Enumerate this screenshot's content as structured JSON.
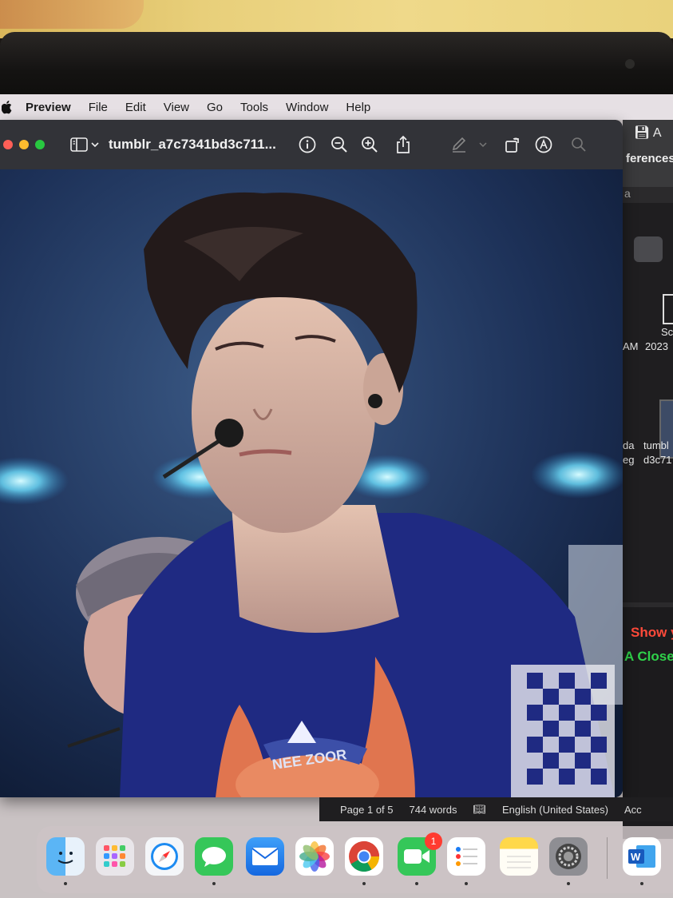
{
  "menubar": {
    "app_name": "Preview",
    "items": [
      "File",
      "Edit",
      "View",
      "Go",
      "Tools",
      "Window",
      "Help"
    ]
  },
  "window": {
    "title": "tumblr_a7c7341bd3c711...",
    "toolbar_icons": [
      "sidebar-icon",
      "chevron-down-icon",
      "info-icon",
      "zoom-out-icon",
      "zoom-in-icon",
      "share-icon",
      "markup-pen-icon",
      "chevron-down-icon",
      "rotate-icon",
      "annotate-icon",
      "search-icon"
    ]
  },
  "background_app": {
    "tab_fragment": "ferences",
    "font_fragment": "a",
    "file_labels": {
      "sc": "Sc",
      "am": "AM",
      "year": "2023",
      "da": "da",
      "eg": "eg",
      "tumbl": "tumbl",
      "d3c71": "d3c71"
    },
    "red_text": "Show y",
    "green_text": "A Close"
  },
  "statusbar": {
    "page": "Page 1 of 5",
    "words": "744 words",
    "language": "English (United States)",
    "accessibility": "Acc"
  },
  "dock": {
    "apps": [
      "Finder",
      "Launchpad",
      "Safari",
      "Messages",
      "Mail",
      "Photos",
      "Chrome",
      "FaceTime",
      "Reminders",
      "Notes",
      "System Settings",
      "Word"
    ],
    "facetime_badge": "1",
    "shirt_text": "NEE ZOOR"
  }
}
